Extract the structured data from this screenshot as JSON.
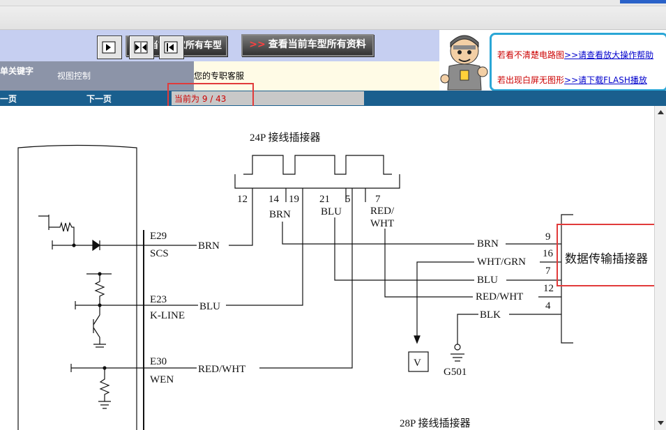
{
  "toolbar": {
    "btn_all_models": "查看当前厂家所有车型",
    "btn_all_docs": "查看当前车型所有资料",
    "btn_all_docs_arrows": ">>"
  },
  "sidebar": {
    "keyword_label": "单关键字",
    "view_control": "视图控制"
  },
  "service_text": "您的专职客服",
  "help": {
    "line1_red": "若看不清楚电路图",
    "line1_link": ">>请查看放大操作帮助",
    "line2_red": "若出现白屏无图形",
    "line2_link": ">>请下载FLASH播放"
  },
  "nav": {
    "prev": "一页",
    "next": "下一页",
    "page_status": "当前为  9 / 43"
  },
  "diagram": {
    "connector24_title": "24P 接线插接器",
    "connector28_title": "28P 接线插接器",
    "data_connector": "数据传输插接器",
    "pins24": [
      "12",
      "14",
      "19",
      "21",
      "5",
      "7"
    ],
    "wires_top": [
      "BRN",
      "BLU",
      "RED/",
      "WHT"
    ],
    "ecu": [
      {
        "pin": "E29",
        "name": "SCS",
        "wire": "BRN"
      },
      {
        "pin": "E23",
        "name": "K-LINE",
        "wire": "BLU"
      },
      {
        "pin": "E30",
        "name": "WEN",
        "wire": "RED/WHT"
      }
    ],
    "dlc": [
      {
        "wire": "BRN",
        "pin": "9"
      },
      {
        "wire": "WHT/GRN",
        "pin": "16"
      },
      {
        "wire": "BLU",
        "pin": "7"
      },
      {
        "wire": "RED/WHT",
        "pin": "12"
      },
      {
        "wire": "BLK",
        "pin": "4"
      }
    ],
    "v_label": "V",
    "ground": "G501"
  }
}
